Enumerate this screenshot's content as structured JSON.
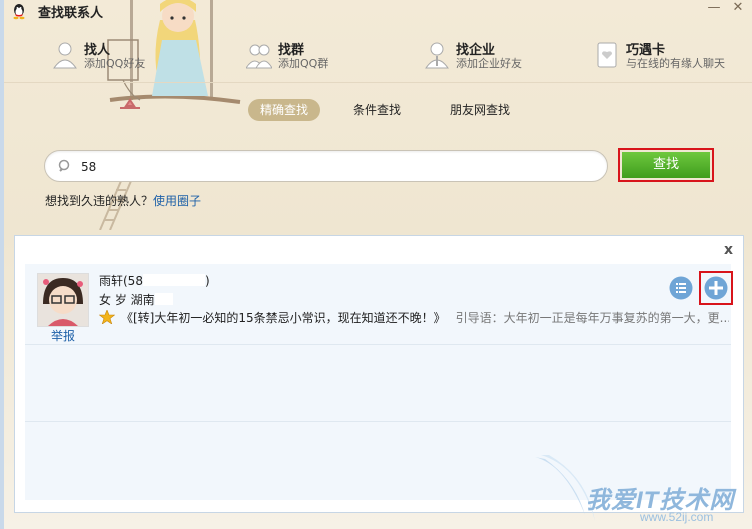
{
  "window": {
    "title": "查找联系人",
    "minimize": "—",
    "close": "✕"
  },
  "topnav": [
    {
      "title": "找人",
      "subtitle": "添加QQ好友",
      "icon": "person-icon"
    },
    {
      "title": "找群",
      "subtitle": "添加QQ群",
      "icon": "group-icon"
    },
    {
      "title": "找企业",
      "subtitle": "添加企业好友",
      "icon": "enterprise-icon"
    },
    {
      "title": "巧遇卡",
      "subtitle": "与在线的有缘人聊天",
      "icon": "card-icon"
    }
  ],
  "subtabs": [
    {
      "label": "精确查找",
      "active": true
    },
    {
      "label": "条件查找",
      "active": false
    },
    {
      "label": "朋友网查找",
      "active": false
    }
  ],
  "search": {
    "value": "58",
    "placeholder": "",
    "button": "查找"
  },
  "hint": {
    "text": "想找到久违的熟人？",
    "link": "使用圈子"
  },
  "result": {
    "close": "x",
    "name": "雨轩(58",
    "name_suffix": ")",
    "info": "女  岁 湖南",
    "status": "《[转]大年初一必知的15条禁忌小常识，现在知道还不晚！》",
    "intro": "引导语：大年初一正是每年万事复苏的第一大，更...",
    "report": "举报"
  },
  "watermark": {
    "text": "我爱IT技术网",
    "url": "www.52ij.com"
  },
  "colors": {
    "accent": "#3f9d1d",
    "highlight": "#d8141b",
    "link": "#1f61a8"
  }
}
